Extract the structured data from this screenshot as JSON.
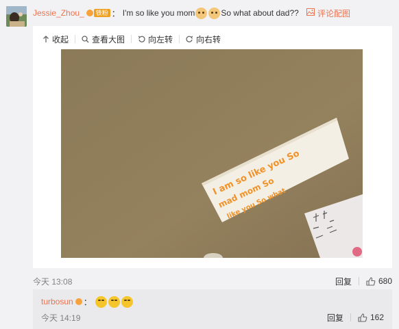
{
  "comment": {
    "username": "Jessie_Zhou_",
    "vip_tag": "铁粉",
    "colon": "：",
    "text_before_emoji": "I'm so like you mom",
    "text_after_emoji": " So what about dad??",
    "emoji_icons": [
      "dog-face-icon",
      "dog-face-icon"
    ],
    "reply_pic_label": "评论配图",
    "time": "今天 13:08",
    "reply_label": "回复",
    "like_count": "680"
  },
  "media_toolbar": {
    "collapse_label": "收起",
    "view_large_label": "查看大图",
    "rotate_left_label": "向左转",
    "rotate_right_label": "向右转"
  },
  "photo": {
    "description_icon": "photo-of-paper-note",
    "note_lines": [
      "I am so like you So",
      "mad mom So",
      "like you So what"
    ]
  },
  "sub_comment": {
    "username": "turbosun",
    "colon": "：",
    "emoji_icons": [
      "laugh-cry-icon",
      "laugh-cry-icon",
      "laugh-cry-icon"
    ],
    "time": "今天 14:19",
    "reply_label": "回复",
    "like_count": "162"
  },
  "colors": {
    "accent": "#eb7350",
    "background": "#f2f2f5",
    "card": "#ffffff",
    "sub_card": "#eaeaec",
    "muted_text": "#808080"
  }
}
